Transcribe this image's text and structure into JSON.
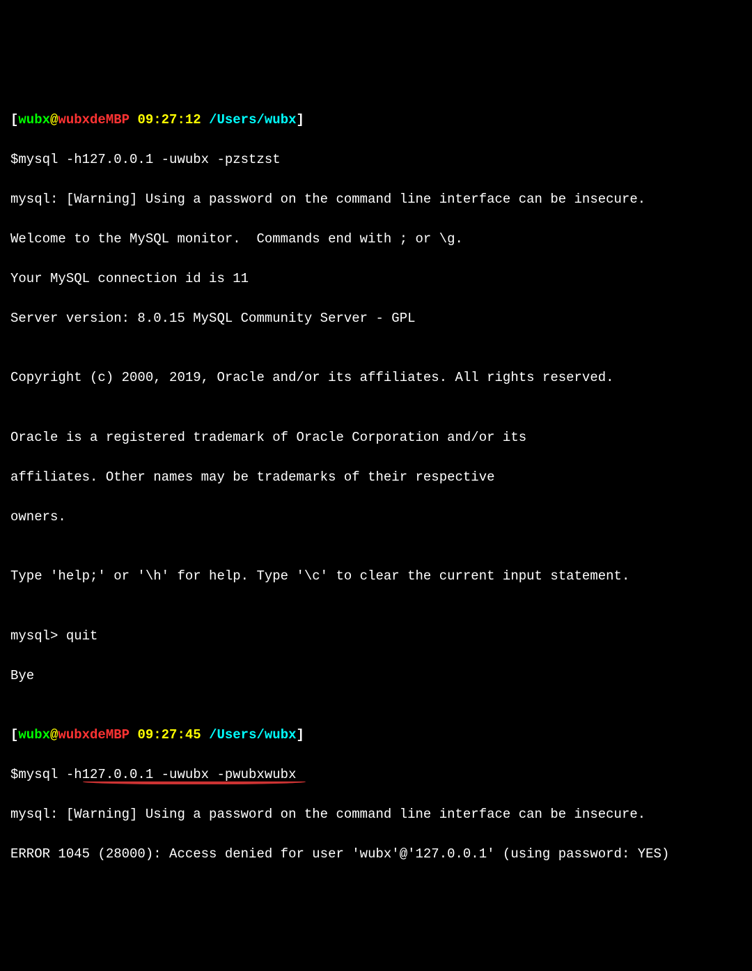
{
  "prompt1": {
    "bracket_open": "[",
    "user": "wubx",
    "at": "@",
    "host": "wubxdeMBP",
    "time": "09:27:12",
    "path": "/Users/wubx",
    "bracket_close": "]"
  },
  "cmd1": "$mysql -h127.0.0.1 -uwubx -pzstzst",
  "lines1": [
    "mysql: [Warning] Using a password on the command line interface can be insecure.",
    "Welcome to the MySQL monitor.  Commands end with ; or \\g.",
    "Your MySQL connection id is 11",
    "Server version: 8.0.15 MySQL Community Server - GPL",
    "",
    "Copyright (c) 2000, 2019, Oracle and/or its affiliates. All rights reserved.",
    "",
    "Oracle is a registered trademark of Oracle Corporation and/or its",
    "affiliates. Other names may be trademarks of their respective",
    "owners.",
    "",
    "Type 'help;' or '\\h' for help. Type '\\c' to clear the current input statement.",
    "",
    "mysql> quit",
    "Bye",
    ""
  ],
  "prompt2": {
    "bracket_open": "[",
    "user": "wubx",
    "at": "@",
    "host": "wubxdeMBP",
    "time": "09:27:45",
    "path": "/Users/wubx",
    "bracket_close": "]"
  },
  "cmd2": "$mysql -h127.0.0.1 -uwubx -pwubxwubx",
  "lines2": [
    "mysql: [Warning] Using a password on the command line interface can be insecure.",
    "ERROR 1045 (28000): Access denied for user 'wubx'@'127.0.0.1' (using password: YES)"
  ]
}
